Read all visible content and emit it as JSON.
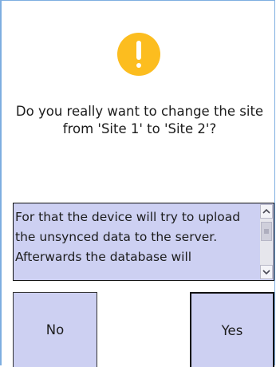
{
  "dialog": {
    "question": "Do you really want to change the site from 'Site 1' to 'Site 2'?",
    "detail": "For that the device will try to upload the unsynced data to the server. Afterwards the database will",
    "icon": "warning-icon",
    "accent_color": "#fcbd1f",
    "panel_color": "#cdd0f2"
  },
  "buttons": {
    "no_label": "No",
    "yes_label": "Yes"
  },
  "scrollbar": {
    "up_icon": "chevron-up-icon",
    "down_icon": "chevron-down-icon"
  }
}
